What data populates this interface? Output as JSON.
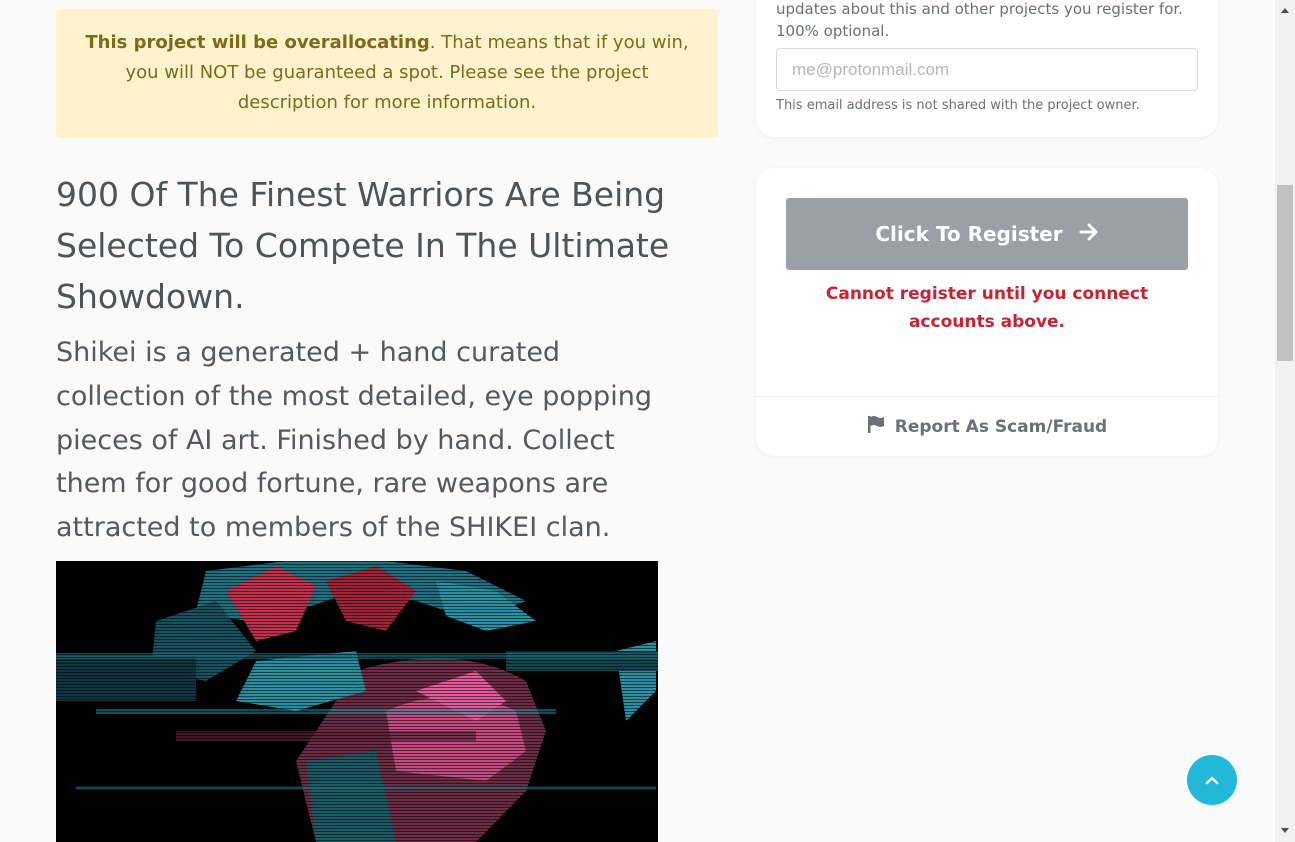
{
  "alert": {
    "bold_text": "This project will be overallocating",
    "text": ". That means that if you win, you will NOT be guaranteed a spot. Please see the project description for more information.",
    "bg_color": "#fff3cd"
  },
  "project": {
    "headline": "900 Of The Finest Warriors Are Being Selected To Compete In The Ultimate Showdown.",
    "description": "Shikei is a generated + hand curated collection of the most detailed, eye popping pieces of AI art. Finished by hand. Collect them for good fortune, rare weapons are attracted to members of the SHIKEI clan."
  },
  "email_card": {
    "note": "updates about this and other projects you register for. 100% optional.",
    "placeholder": "me@protonmail.com",
    "help": "This email address is not shared with the project owner."
  },
  "register_card": {
    "button_label": "Click To Register",
    "button_icon": "arrow-right-icon",
    "error": "Cannot register until you connect accounts above.",
    "error_color": "#c82333",
    "report_label": "Report As Scam/Fraud",
    "report_icon": "flag-icon"
  },
  "back_to_top": {
    "icon": "chevron-up-icon",
    "color": "#22b8d8"
  }
}
